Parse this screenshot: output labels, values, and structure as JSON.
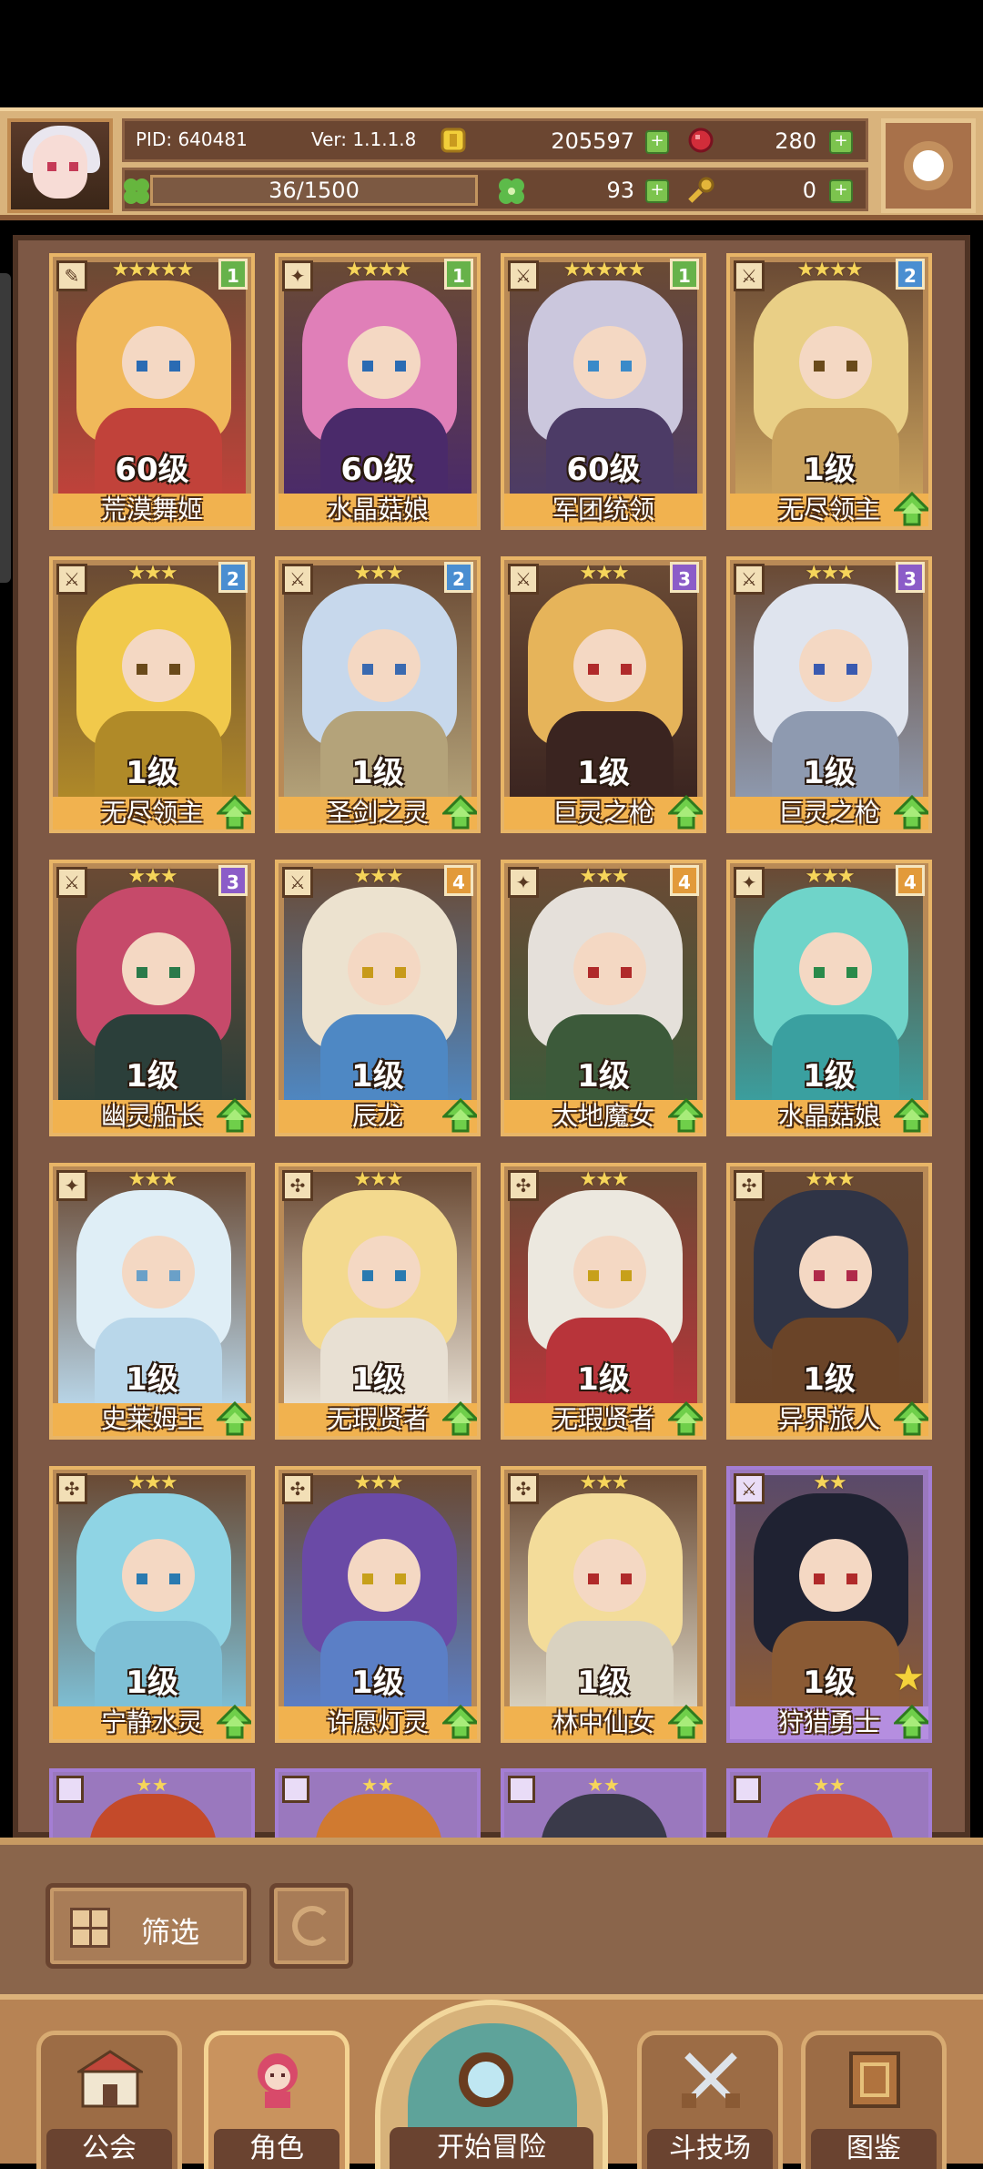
{
  "header": {
    "pid": "PID: 640481",
    "version": "Ver: 1.1.1.8",
    "gold": "205597",
    "gems": "280",
    "stamina": "36/1500",
    "clover": "93",
    "keys": "0"
  },
  "colors": {
    "header_bg": "#d9b37c",
    "panel_bg": "#7d5845",
    "legendary_name": "#f1b24f",
    "epic_name": "#b58ee0",
    "plus_green": "#7cc44e"
  },
  "cards": [
    {
      "name": "荒漠舞姬",
      "level": "60级",
      "stars": "★★★★★",
      "badge": "1",
      "tier": "legendary",
      "badge_color": "#67b24a",
      "hair": "#f0b85a",
      "body": "#c1423a",
      "eye": "#2a6bb3",
      "role": "slingshot",
      "show_up": false
    },
    {
      "name": "水晶菇娘",
      "level": "60级",
      "stars": "★★★★",
      "badge": "1",
      "tier": "legendary",
      "badge_color": "#67b24a",
      "hair": "#e07fb8",
      "body": "#4a2a6a",
      "eye": "#2a6bb3",
      "role": "staff",
      "show_up": false
    },
    {
      "name": "军团统领",
      "level": "60级",
      "stars": "★★★★★",
      "badge": "1",
      "tier": "legendary",
      "badge_color": "#67b24a",
      "hair": "#cbc7dd",
      "body": "#4c3b66",
      "eye": "#3a8ac9",
      "role": "sword",
      "show_up": false
    },
    {
      "name": "无尽领主",
      "level": "1级",
      "stars": "★★★★",
      "badge": "2",
      "tier": "legendary",
      "badge_color": "#4a8ed1",
      "hair": "#e9cf86",
      "body": "#c9a15c",
      "eye": "#6a4a1a",
      "role": "sword",
      "show_up": true
    },
    {
      "name": "无尽领主",
      "level": "1级",
      "stars": "★★★",
      "badge": "2",
      "tier": "legendary",
      "badge_color": "#4a8ed1",
      "hair": "#f1c94b",
      "body": "#b08a28",
      "eye": "#6a4a1a",
      "role": "sword",
      "show_up": true
    },
    {
      "name": "圣剑之灵",
      "level": "1级",
      "stars": "★★★",
      "badge": "2",
      "tier": "legendary",
      "badge_color": "#4a8ed1",
      "hair": "#c7d8ec",
      "body": "#b4a37a",
      "eye": "#3a6ab0",
      "role": "sword",
      "show_up": true
    },
    {
      "name": "巨灵之枪",
      "level": "1级",
      "stars": "★★★",
      "badge": "3",
      "tier": "legendary",
      "badge_color": "#8b5cc8",
      "hair": "#e6b45a",
      "body": "#3a2420",
      "eye": "#b02a2a",
      "role": "sword",
      "show_up": true
    },
    {
      "name": "巨灵之枪",
      "level": "1级",
      "stars": "★★★",
      "badge": "3",
      "tier": "legendary",
      "badge_color": "#8b5cc8",
      "hair": "#dfe4ee",
      "body": "#8e9ab0",
      "eye": "#3a5ab0",
      "role": "sword",
      "show_up": true
    },
    {
      "name": "幽灵船长",
      "level": "1级",
      "stars": "★★★",
      "badge": "3",
      "tier": "legendary",
      "badge_color": "#8b5cc8",
      "hair": "#c64a6a",
      "body": "#2b3f3a",
      "eye": "#2a7a4a",
      "role": "sword",
      "show_up": true
    },
    {
      "name": "辰龙",
      "level": "1级",
      "stars": "★★★",
      "badge": "4",
      "tier": "legendary",
      "badge_color": "#e29a3a",
      "hair": "#ece2cf",
      "body": "#4e88c4",
      "eye": "#c79a1a",
      "role": "sword",
      "show_up": true
    },
    {
      "name": "太地魔女",
      "level": "1级",
      "stars": "★★★",
      "badge": "4",
      "tier": "legendary",
      "badge_color": "#e29a3a",
      "hair": "#e5e0da",
      "body": "#3c5a3a",
      "eye": "#b02a2a",
      "role": "staff",
      "show_up": true
    },
    {
      "name": "水晶菇娘",
      "level": "1级",
      "stars": "★★★",
      "badge": "4",
      "tier": "legendary",
      "badge_color": "#e29a3a",
      "hair": "#6fd4c9",
      "body": "#3aa0a0",
      "eye": "#2a8a4a",
      "role": "staff",
      "show_up": true
    },
    {
      "name": "史莱姆王",
      "level": "1级",
      "stars": "★★★",
      "badge": "",
      "tier": "legendary",
      "badge_color": "",
      "hair": "#dfeef6",
      "body": "#b9d7ea",
      "eye": "#6aa0c8",
      "role": "staff",
      "show_up": true
    },
    {
      "name": "无瑕贤者",
      "level": "1级",
      "stars": "★★★",
      "badge": "",
      "tier": "legendary",
      "badge_color": "",
      "hair": "#f3d98e",
      "body": "#e8e0d3",
      "eye": "#2a7ab0",
      "role": "shield",
      "show_up": true
    },
    {
      "name": "无瑕贤者",
      "level": "1级",
      "stars": "★★★",
      "badge": "",
      "tier": "legendary",
      "badge_color": "",
      "hair": "#ece8df",
      "body": "#b8343a",
      "eye": "#c7a01a",
      "role": "shield",
      "show_up": true
    },
    {
      "name": "异界旅人",
      "level": "1级",
      "stars": "★★★",
      "badge": "",
      "tier": "legendary",
      "badge_color": "",
      "hair": "#2f3446",
      "body": "#6a4428",
      "eye": "#b02a4a",
      "role": "shield",
      "show_up": true
    },
    {
      "name": "宁静水灵",
      "level": "1级",
      "stars": "★★★",
      "badge": "",
      "tier": "legendary",
      "badge_color": "",
      "hair": "#8fd4e4",
      "body": "#7ec0d6",
      "eye": "#2a7ab0",
      "role": "shield",
      "show_up": true
    },
    {
      "name": "许愿灯灵",
      "level": "1级",
      "stars": "★★★",
      "badge": "",
      "tier": "legendary",
      "badge_color": "",
      "hair": "#6a4aa6",
      "body": "#5b7fc6",
      "eye": "#c7a01a",
      "role": "shield",
      "show_up": true
    },
    {
      "name": "林中仙女",
      "level": "1级",
      "stars": "★★★",
      "badge": "",
      "tier": "legendary",
      "badge_color": "",
      "hair": "#f3dc9a",
      "body": "#d9d2c0",
      "eye": "#b02a2a",
      "role": "shield",
      "show_up": true
    },
    {
      "name": "狩猎勇士",
      "level": "1级",
      "stars": "★★",
      "badge": "",
      "tier": "epic",
      "badge_color": "",
      "hair": "#1f2232",
      "body": "#8a5a34",
      "eye": "#b02a2a",
      "role": "sword",
      "show_up": true,
      "favorite": true
    }
  ],
  "peek_cards": [
    {
      "stars": "★★",
      "hair": "#c44a2a"
    },
    {
      "stars": "★★",
      "hair": "#d07a30"
    },
    {
      "stars": "★★",
      "hair": "#3a3a4a"
    },
    {
      "stars": "★★",
      "hair": "#c84a3a"
    }
  ],
  "controls": {
    "filter_label": "筛选"
  },
  "nav": {
    "guild": "公会",
    "character": "角色",
    "adventure": "开始冒险",
    "arena": "斗技场",
    "codex": "图鉴"
  }
}
